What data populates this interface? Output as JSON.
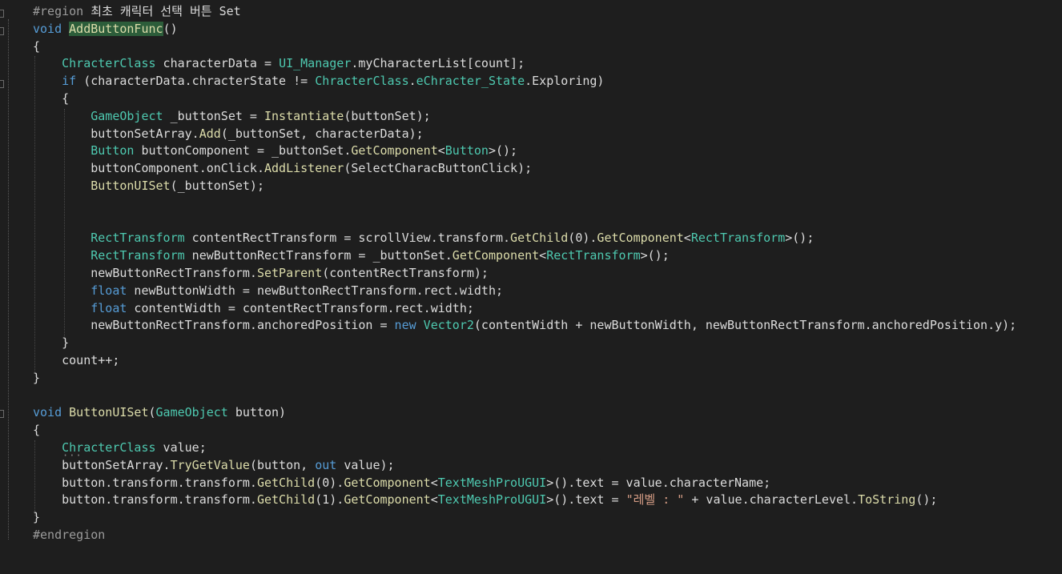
{
  "editor": {
    "lines": [
      [
        {
          "t": "#region ",
          "c": "cm"
        },
        {
          "t": "최초 캐릭터 선택 버튼 Set",
          "c": "tx"
        }
      ],
      [
        {
          "t": "void ",
          "c": "kw"
        },
        {
          "t": "AddButtonFunc",
          "c": "hl-word"
        },
        {
          "t": "()",
          "c": "tx"
        }
      ],
      [
        {
          "t": "{",
          "c": "tx"
        }
      ],
      [
        {
          "t": "    ",
          "c": "tx"
        },
        {
          "t": "ChracterClass",
          "c": "ty"
        },
        {
          "t": " characterData = ",
          "c": "tx"
        },
        {
          "t": "UI_Manager",
          "c": "ty"
        },
        {
          "t": ".myCharacterList[count];",
          "c": "tx"
        }
      ],
      [
        {
          "t": "    ",
          "c": "tx"
        },
        {
          "t": "if",
          "c": "kw"
        },
        {
          "t": " (characterData.chracterState != ",
          "c": "tx"
        },
        {
          "t": "ChracterClass",
          "c": "ty"
        },
        {
          "t": ".",
          "c": "tx"
        },
        {
          "t": "eChracter_State",
          "c": "ty"
        },
        {
          "t": ".Exploring)",
          "c": "tx"
        }
      ],
      [
        {
          "t": "    {",
          "c": "tx"
        }
      ],
      [
        {
          "t": "        ",
          "c": "tx"
        },
        {
          "t": "GameObject",
          "c": "ty"
        },
        {
          "t": " _buttonSet = ",
          "c": "tx"
        },
        {
          "t": "Instantiate",
          "c": "fn"
        },
        {
          "t": "(buttonSet);",
          "c": "tx"
        }
      ],
      [
        {
          "t": "        buttonSetArray.",
          "c": "tx"
        },
        {
          "t": "Add",
          "c": "fn"
        },
        {
          "t": "(_buttonSet, characterData);",
          "c": "tx"
        }
      ],
      [
        {
          "t": "        ",
          "c": "tx"
        },
        {
          "t": "Button",
          "c": "ty"
        },
        {
          "t": " buttonComponent = _buttonSet.",
          "c": "tx"
        },
        {
          "t": "GetComponent",
          "c": "fn"
        },
        {
          "t": "<",
          "c": "tx"
        },
        {
          "t": "Button",
          "c": "ty"
        },
        {
          "t": ">();",
          "c": "tx"
        }
      ],
      [
        {
          "t": "        buttonComponent.onClick.",
          "c": "tx"
        },
        {
          "t": "AddListener",
          "c": "fn"
        },
        {
          "t": "(SelectCharacButtonClick);",
          "c": "tx"
        }
      ],
      [
        {
          "t": "        ",
          "c": "tx"
        },
        {
          "t": "ButtonUISet",
          "c": "fn"
        },
        {
          "t": "(_buttonSet);",
          "c": "tx"
        }
      ],
      [
        {
          "t": "",
          "c": "tx"
        }
      ],
      [
        {
          "t": "",
          "c": "tx"
        }
      ],
      [
        {
          "t": "        ",
          "c": "tx"
        },
        {
          "t": "RectTransform",
          "c": "ty"
        },
        {
          "t": " contentRectTransform = scrollView.transform.",
          "c": "tx"
        },
        {
          "t": "GetChild",
          "c": "fn"
        },
        {
          "t": "(0).",
          "c": "tx"
        },
        {
          "t": "GetComponent",
          "c": "fn"
        },
        {
          "t": "<",
          "c": "tx"
        },
        {
          "t": "RectTransform",
          "c": "ty"
        },
        {
          "t": ">();",
          "c": "tx"
        }
      ],
      [
        {
          "t": "        ",
          "c": "tx"
        },
        {
          "t": "RectTransform",
          "c": "ty"
        },
        {
          "t": " newButtonRectTransform = _buttonSet.",
          "c": "tx"
        },
        {
          "t": "GetComponent",
          "c": "fn"
        },
        {
          "t": "<",
          "c": "tx"
        },
        {
          "t": "RectTransform",
          "c": "ty"
        },
        {
          "t": ">();",
          "c": "tx"
        }
      ],
      [
        {
          "t": "        newButtonRectTransform.",
          "c": "tx"
        },
        {
          "t": "SetParent",
          "c": "fn"
        },
        {
          "t": "(contentRectTransform);",
          "c": "tx"
        }
      ],
      [
        {
          "t": "        ",
          "c": "tx"
        },
        {
          "t": "float",
          "c": "kw"
        },
        {
          "t": " newButtonWidth = newButtonRectTransform.rect.width;",
          "c": "tx"
        }
      ],
      [
        {
          "t": "        ",
          "c": "tx"
        },
        {
          "t": "float",
          "c": "kw"
        },
        {
          "t": " contentWidth = contentRectTransform.rect.width;",
          "c": "tx"
        }
      ],
      [
        {
          "t": "        newButtonRectTransform.anchoredPosition = ",
          "c": "tx"
        },
        {
          "t": "new",
          "c": "kw"
        },
        {
          "t": " ",
          "c": "tx"
        },
        {
          "t": "Vector2",
          "c": "ty"
        },
        {
          "t": "(contentWidth + newButtonWidth, newButtonRectTransform.anchoredPosition.y);",
          "c": "tx"
        }
      ],
      [
        {
          "t": "    }",
          "c": "tx"
        }
      ],
      [
        {
          "t": "    count++;",
          "c": "tx"
        }
      ],
      [
        {
          "t": "}",
          "c": "tx"
        }
      ],
      [
        {
          "t": "",
          "c": "tx"
        }
      ],
      [
        {
          "t": "void ",
          "c": "kw"
        },
        {
          "t": "ButtonUISet",
          "c": "fn"
        },
        {
          "t": "(",
          "c": "tx"
        },
        {
          "t": "GameObject",
          "c": "ty"
        },
        {
          "t": " button)",
          "c": "tx"
        }
      ],
      [
        {
          "t": "{",
          "c": "tx"
        }
      ],
      [
        {
          "t": "    ",
          "c": "tx"
        },
        {
          "t": "ChracterClass",
          "c": "ty"
        },
        {
          "t": " value;",
          "c": "tx"
        }
      ],
      [
        {
          "t": "    buttonSetArray.",
          "c": "tx"
        },
        {
          "t": "TryGetValue",
          "c": "fn"
        },
        {
          "t": "(button, ",
          "c": "tx"
        },
        {
          "t": "out",
          "c": "kw"
        },
        {
          "t": " value);",
          "c": "tx"
        }
      ],
      [
        {
          "t": "    button.transform.transform.",
          "c": "tx"
        },
        {
          "t": "GetChild",
          "c": "fn"
        },
        {
          "t": "(0).",
          "c": "tx"
        },
        {
          "t": "GetComponent",
          "c": "fn"
        },
        {
          "t": "<",
          "c": "tx"
        },
        {
          "t": "TextMeshProUGUI",
          "c": "ty"
        },
        {
          "t": ">().text = value.characterName;",
          "c": "tx"
        }
      ],
      [
        {
          "t": "    button.transform.transform.",
          "c": "tx"
        },
        {
          "t": "GetChild",
          "c": "fn"
        },
        {
          "t": "(1).",
          "c": "tx"
        },
        {
          "t": "GetComponent",
          "c": "fn"
        },
        {
          "t": "<",
          "c": "tx"
        },
        {
          "t": "TextMeshProUGUI",
          "c": "ty"
        },
        {
          "t": ">().text = ",
          "c": "tx"
        },
        {
          "t": "\"레벨 : \"",
          "c": "st"
        },
        {
          "t": " + value.characterLevel.",
          "c": "tx"
        },
        {
          "t": "ToString",
          "c": "fn"
        },
        {
          "t": "();",
          "c": "tx"
        }
      ],
      [
        {
          "t": "}",
          "c": "tx"
        }
      ],
      [
        {
          "t": "#endregion",
          "c": "cm"
        }
      ]
    ]
  },
  "colors": {
    "background": "#1e1e1e",
    "keyword": "#569cd6",
    "type": "#4ec9b0",
    "method": "#dcdcaa",
    "text": "#dcdcdc",
    "string": "#d69d85",
    "preprocessor": "#9b9b9b"
  }
}
